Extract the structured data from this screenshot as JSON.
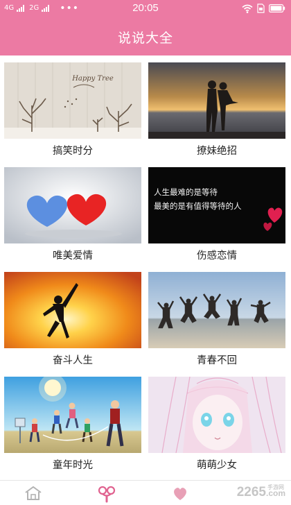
{
  "status_bar": {
    "signal_1": "4G",
    "signal_2": "2G",
    "more": "•••",
    "time": "20:05",
    "icons": [
      "wifi-icon",
      "sim-icon",
      "battery-icon"
    ]
  },
  "header": {
    "title": "说说大全"
  },
  "categories": [
    {
      "label": "搞笑时分"
    },
    {
      "label": "撩妹绝招"
    },
    {
      "label": "唯美爱情"
    },
    {
      "label": "伤感恋情"
    },
    {
      "label": "奋斗人生"
    },
    {
      "label": "青春不回"
    },
    {
      "label": "童年时光"
    },
    {
      "label": "萌萌少女"
    }
  ],
  "thumbnails": {
    "happy_tree_text": "Happy Tree",
    "sad_quote_line1": "人生最难的是等待",
    "sad_quote_line2": "最美的是有值得等待的人"
  },
  "tab_bar": {
    "tabs": [
      {
        "icon": "home-icon",
        "active": false
      },
      {
        "icon": "pacifier-icon",
        "active": true
      }
    ],
    "watermark": "2265",
    "watermark_suffix": ".com",
    "watermark_sub": "手游网"
  },
  "colors": {
    "accent": "#ec7aa3",
    "tab_active": "#e0628f",
    "tab_inactive": "#b3b3b3"
  }
}
